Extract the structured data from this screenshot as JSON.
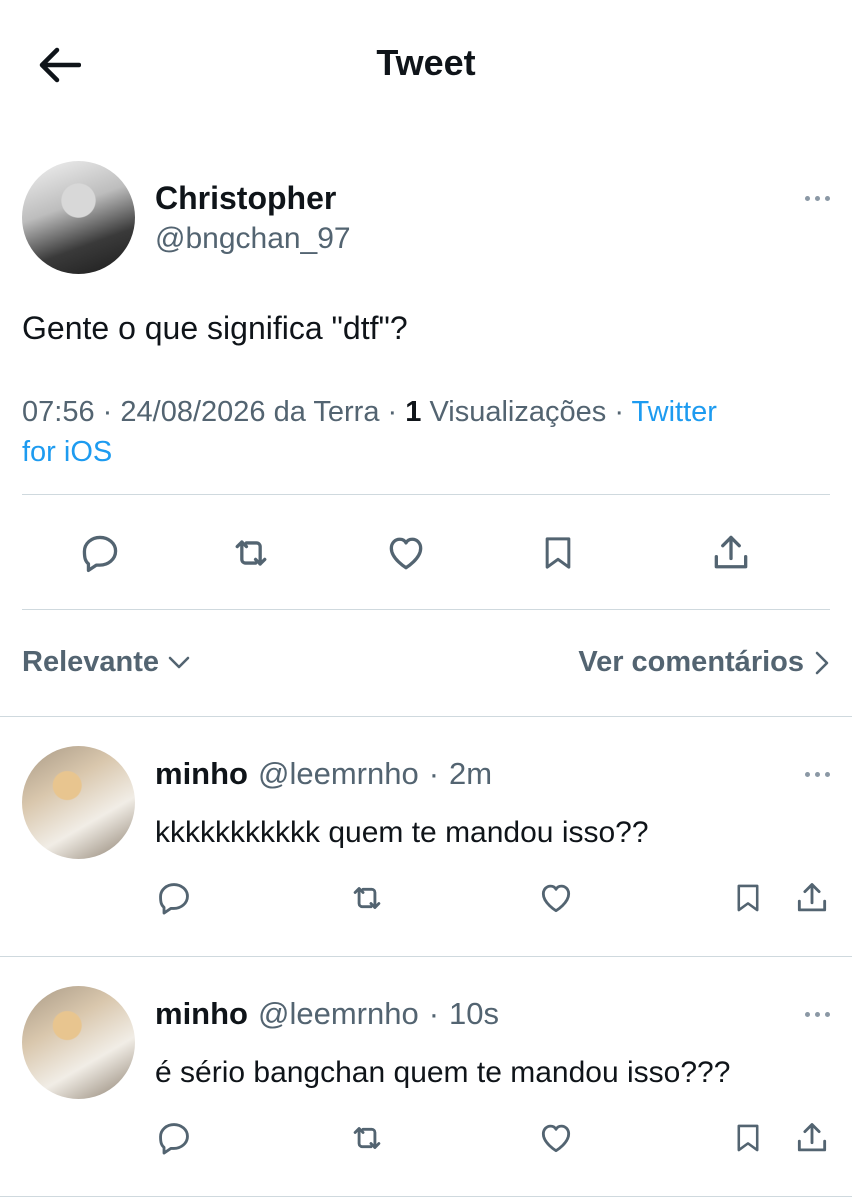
{
  "header": {
    "title": "Tweet"
  },
  "tweet": {
    "author_name": "Christopher",
    "author_handle": "@bngchan_97",
    "text": "Gente o que significa \"dtf\"?",
    "time": "07:56",
    "date": "24/08/2026",
    "location": "da Terra",
    "views_count": "1",
    "views_label": "Visualizações",
    "source_line1": "Twitter",
    "source_line2": "for iOS",
    "separator": "·"
  },
  "sort": {
    "label": "Relevante",
    "comments_link": "Ver comentários"
  },
  "replies": [
    {
      "name": "minho",
      "handle": "@leemrnho",
      "separator": "·",
      "time": "2m",
      "text": "kkkkkkkkkkk quem te mandou isso??"
    },
    {
      "name": "minho",
      "handle": "@leemrnho",
      "separator": "·",
      "time": "10s",
      "text": "é sério bangchan quem te mandou isso???"
    }
  ],
  "icons": {
    "back": "arrow-left-icon",
    "more": "more-horizontal-icon",
    "reply": "comment-icon",
    "retweet": "retweet-icon",
    "like": "heart-icon",
    "bookmark": "bookmark-icon",
    "share": "share-icon"
  },
  "colors": {
    "link": "#1d9bf0",
    "secondary_text": "#536471",
    "divider": "#cfd9de",
    "icon": "#536471"
  }
}
